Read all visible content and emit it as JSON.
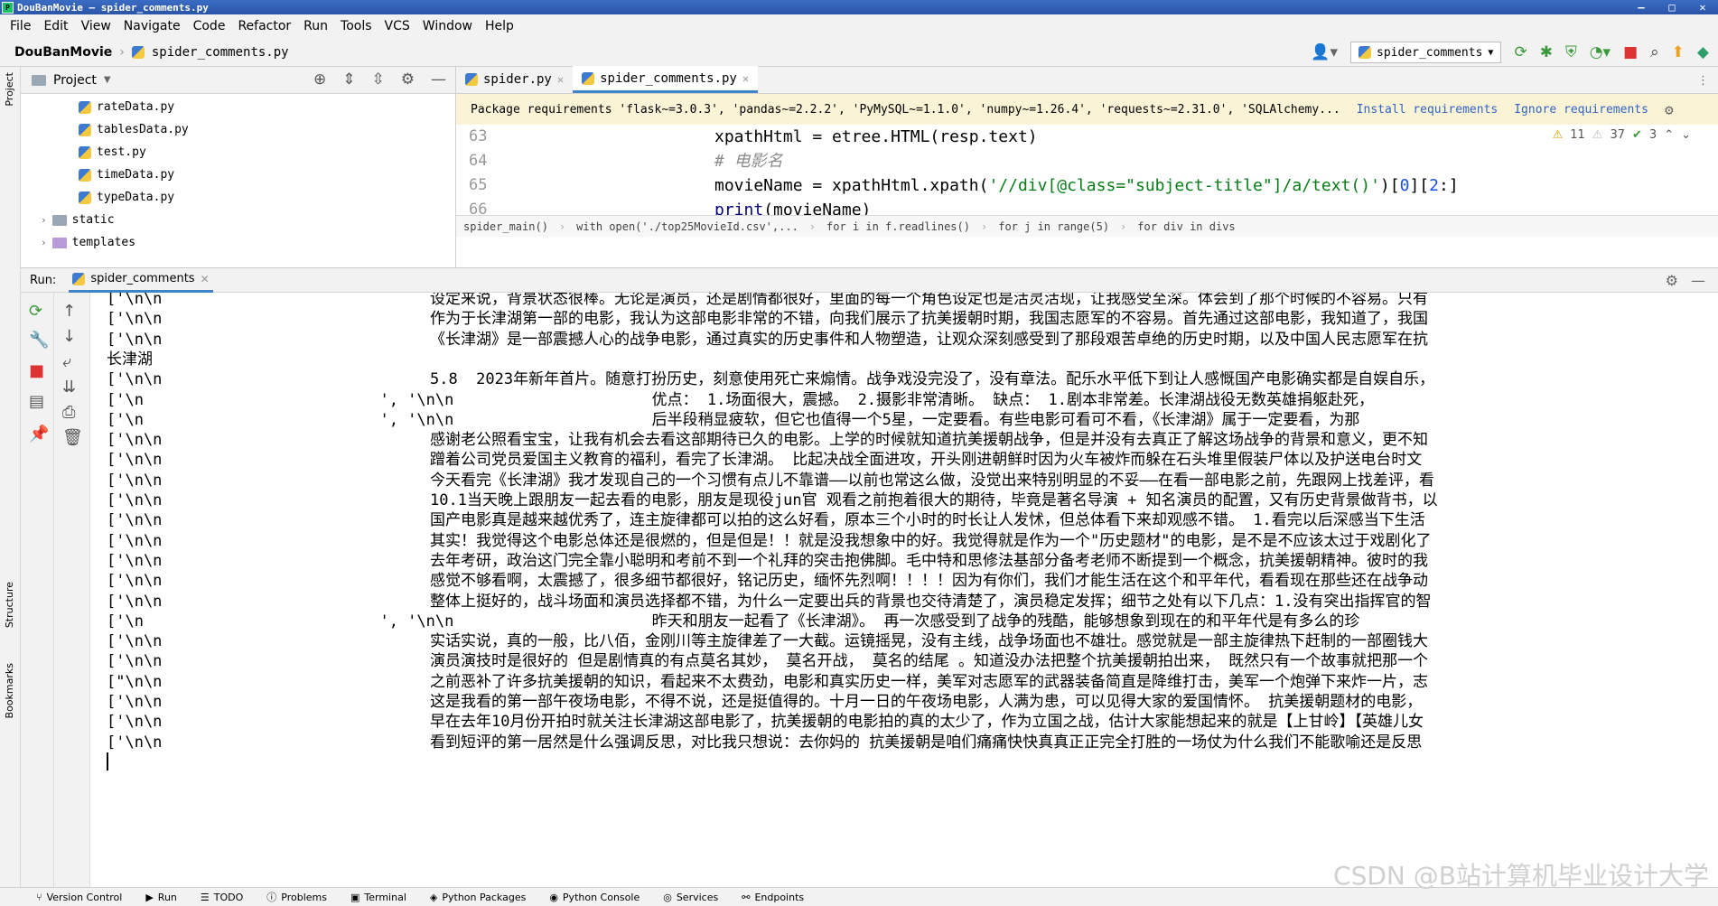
{
  "window": {
    "title": "DouBanMovie – spider_comments.py",
    "controls": [
      "–",
      "□",
      "✕"
    ]
  },
  "menu": [
    "File",
    "Edit",
    "View",
    "Navigate",
    "Code",
    "Refactor",
    "Run",
    "Tools",
    "VCS",
    "Window",
    "Help"
  ],
  "nav": {
    "project": "DouBanMovie",
    "file": "spider_comments.py",
    "run_config": "spider_comments"
  },
  "project_panel": {
    "title": "Project",
    "files": [
      "rateData.py",
      "tablesData.py",
      "test.py",
      "timeData.py",
      "typeData.py"
    ],
    "folders": [
      "static",
      "templates"
    ]
  },
  "editor": {
    "tabs": [
      {
        "label": "spider.py"
      },
      {
        "label": "spider_comments.py"
      }
    ],
    "banner": {
      "text": "Package requirements 'flask~=3.0.3', 'pandas~=2.2.2', 'PyMySQL~=1.1.0', 'numpy~=1.26.4', 'requests~=2.31.0', 'SQLAlchemy...",
      "install": "Install requirements",
      "ignore": "Ignore requirements"
    },
    "line_numbers": [
      "63",
      "64",
      "65",
      "66"
    ],
    "code": {
      "l63": "xpathHtml = etree.HTML(resp.text)",
      "l64": "# 电影名",
      "l65_a": "movieName = xpathHtml.xpath(",
      "l65_b": "'//div[@class=\"subject-title\"]/a/text()'",
      "l65_c": ")[",
      "l65_d": "0",
      "l65_e": "][",
      "l65_f": "2",
      "l65_g": ":]",
      "l66_a": "print",
      "l66_b": "(movieName)"
    },
    "inspections": {
      "warnings": "11",
      "weak": "37",
      "ok": "3"
    },
    "breadcrumbs": [
      "spider_main()",
      "with open('./top25MovieId.csv',...",
      "for i in f.readlines()",
      "for j in range(5)",
      "for div in divs"
    ]
  },
  "run_panel": {
    "label": "Run:",
    "tab": "spider_comments",
    "left_lines": [
      "['\\n\\n",
      "['\\n\\n",
      "['\\n\\n",
      "长津湖",
      "['\\n\\n",
      "['\\n",
      "['\\n",
      "['\\n\\n",
      "['\\n\\n",
      "['\\n\\n",
      "['\\n\\n",
      "['\\n\\n",
      "['\\n\\n",
      "['\\n\\n",
      "['\\n\\n",
      "['\\n\\n",
      "['\\n",
      "['\\n\\n",
      "['\\n\\n",
      "[\"\\n\\n",
      "['\\n\\n",
      "['\\n\\n",
      "['\\n\\n"
    ],
    "middle_fragments": [
      {
        "row": 5,
        "text": "  ', '\\n\\n"
      },
      {
        "row": 6,
        "text": "  ', '\\n\\n"
      },
      {
        "row": 16,
        "text": "  ', '\\n\\n"
      }
    ],
    "right_lines": [
      {
        "row": 0,
        "text": "设定来说，背景状态很棒。无论是演员，还是剧情都很好，里面的每一个角色设定也是活灵活现，让我感受至深。体会到了那个时候的不容易。只有"
      },
      {
        "row": 1,
        "text": "作为于长津湖第一部的电影，我认为这部电影非常的不错，向我们展示了抗美援朝时期，我国志愿军的不容易。首先通过这部电影，我知道了，我国"
      },
      {
        "row": 2,
        "text": "《长津湖》是一部震撼人心的战争电影，通过真实的历史事件和人物塑造，让观众深刻感受到了那段艰苦卓绝的历史时期，以及中国人民志愿军在抗"
      },
      {
        "row": 4,
        "text": "5.8  2023年新年首片。随意打扮历史，刻意使用死亡来煽情。战争戏没完没了，没有章法。配乐水平低下到让人感慨国产电影确实都是自娱自乐，"
      },
      {
        "row": 5,
        "text": "                        优点： 1.场面很大，震撼。 2.摄影非常清晰。 缺点： 1.剧本非常差。长津湖战役无数英雄捐躯赴死，"
      },
      {
        "row": 6,
        "text": "                        后半段稍显疲软，但它也值得一个5星，一定要看。有些电影可看可不看，《长津湖》属于一定要看，为那"
      },
      {
        "row": 7,
        "text": "感谢老公照看宝宝，让我有机会去看这部期待已久的电影。上学的时候就知道抗美援朝战争，但是并没有去真正了解这场战争的背景和意义，更不知"
      },
      {
        "row": 8,
        "text": "蹭着公司党员爱国主义教育的福利，看完了长津湖。 比起决战全面进攻，开头刚进朝鲜时因为火车被炸而躲在石头堆里假装尸体以及护送电台时文"
      },
      {
        "row": 9,
        "text": "今天看完《长津湖》我才发现自己的一个习惯有点儿不靠谱——以前也常这么做，没觉出来特别明显的不妥——在看一部电影之前，先跟网上找差评，看"
      },
      {
        "row": 10,
        "text": "10.1当天晚上跟朋友一起去看的电影，朋友是现役jun官 观看之前抱着很大的期待，毕竟是著名导演 + 知名演员的配置，又有历史背景做背书，以"
      },
      {
        "row": 11,
        "text": "国产电影真是越来越优秀了，连主旋律都可以拍的这么好看，原本三个小时的时长让人发怵，但总体看下来却观感不错。 1.看完以后深感当下生活"
      },
      {
        "row": 12,
        "text": "其实！我觉得这个电影总体还是很燃的，但是但是！！就是没我想象中的好。我觉得就是作为一个\"历史题材\"的电影，是不是不应该太过于戏剧化了"
      },
      {
        "row": 13,
        "text": "去年考研，政治这门完全靠小聪明和考前不到一个礼拜的突击抱佛脚。毛中特和思修法基部分备考老师不断提到一个概念，抗美援朝精神。彼时的我"
      },
      {
        "row": 14,
        "text": "感觉不够看啊，太震撼了，很多细节都很好，铭记历史，缅怀先烈啊！！！！因为有你们，我们才能生活在这个和平年代，看看现在那些还在战争动"
      },
      {
        "row": 15,
        "text": "整体上挺好的，战斗场面和演员选择都不错，为什么一定要出兵的背景也交待清楚了，演员稳定发挥；细节之处有以下几点：1.没有突出指挥官的智"
      },
      {
        "row": 16,
        "text": "                        昨天和朋友一起看了《长津湖》。 再一次感受到了战争的残酷，能够想象到现在的和平年代是有多么的珍"
      },
      {
        "row": 17,
        "text": "实话实说，真的一般，比八佰，金刚川等主旋律差了一大截。运镜摇晃，没有主线，战争场面也不雄壮。感觉就是一部主旋律热下赶制的一部圈钱大"
      },
      {
        "row": 18,
        "text": "演员演技时是很好的 但是剧情真的有点莫名其妙， 莫名开战， 莫名的结尾 。知道没办法把整个抗美援朝拍出来， 既然只有一个故事就把那一个"
      },
      {
        "row": 19,
        "text": "之前恶补了许多抗美援朝的知识，看起来不太费劲，电影和真实历史一样，美军对志愿军的武器装备简直是降维打击，美军一个炮弹下来炸一片，志"
      },
      {
        "row": 20,
        "text": "这是我看的第一部午夜场电影，不得不说，还是挺值得的。十月一日的午夜场电影，人满为患，可以见得大家的爱国情怀。 抗美援朝题材的电影，"
      },
      {
        "row": 21,
        "text": "早在去年10月份开拍时就关注长津湖这部电影了，抗美援朝的电影拍的真的太少了，作为立国之战，估计大家能想起来的就是【上甘岭】【英雄儿女"
      },
      {
        "row": 22,
        "text": "看到短评的第一居然是什么强调反思，对比我只想说：去你妈的 抗美援朝是咱们痛痛快快真真正正完全打胜的一场仗为什么我们不能歌喻还是反思"
      }
    ]
  },
  "left_strip": {
    "project": "Project",
    "structure": "Structure",
    "bookmarks": "Bookmarks"
  },
  "statusbar": [
    "Version Control",
    "Run",
    "TODO",
    "Problems",
    "Terminal",
    "Python Packages",
    "Python Console",
    "Services",
    "Endpoints"
  ],
  "watermark": "CSDN @B站计算机毕业设计大学"
}
